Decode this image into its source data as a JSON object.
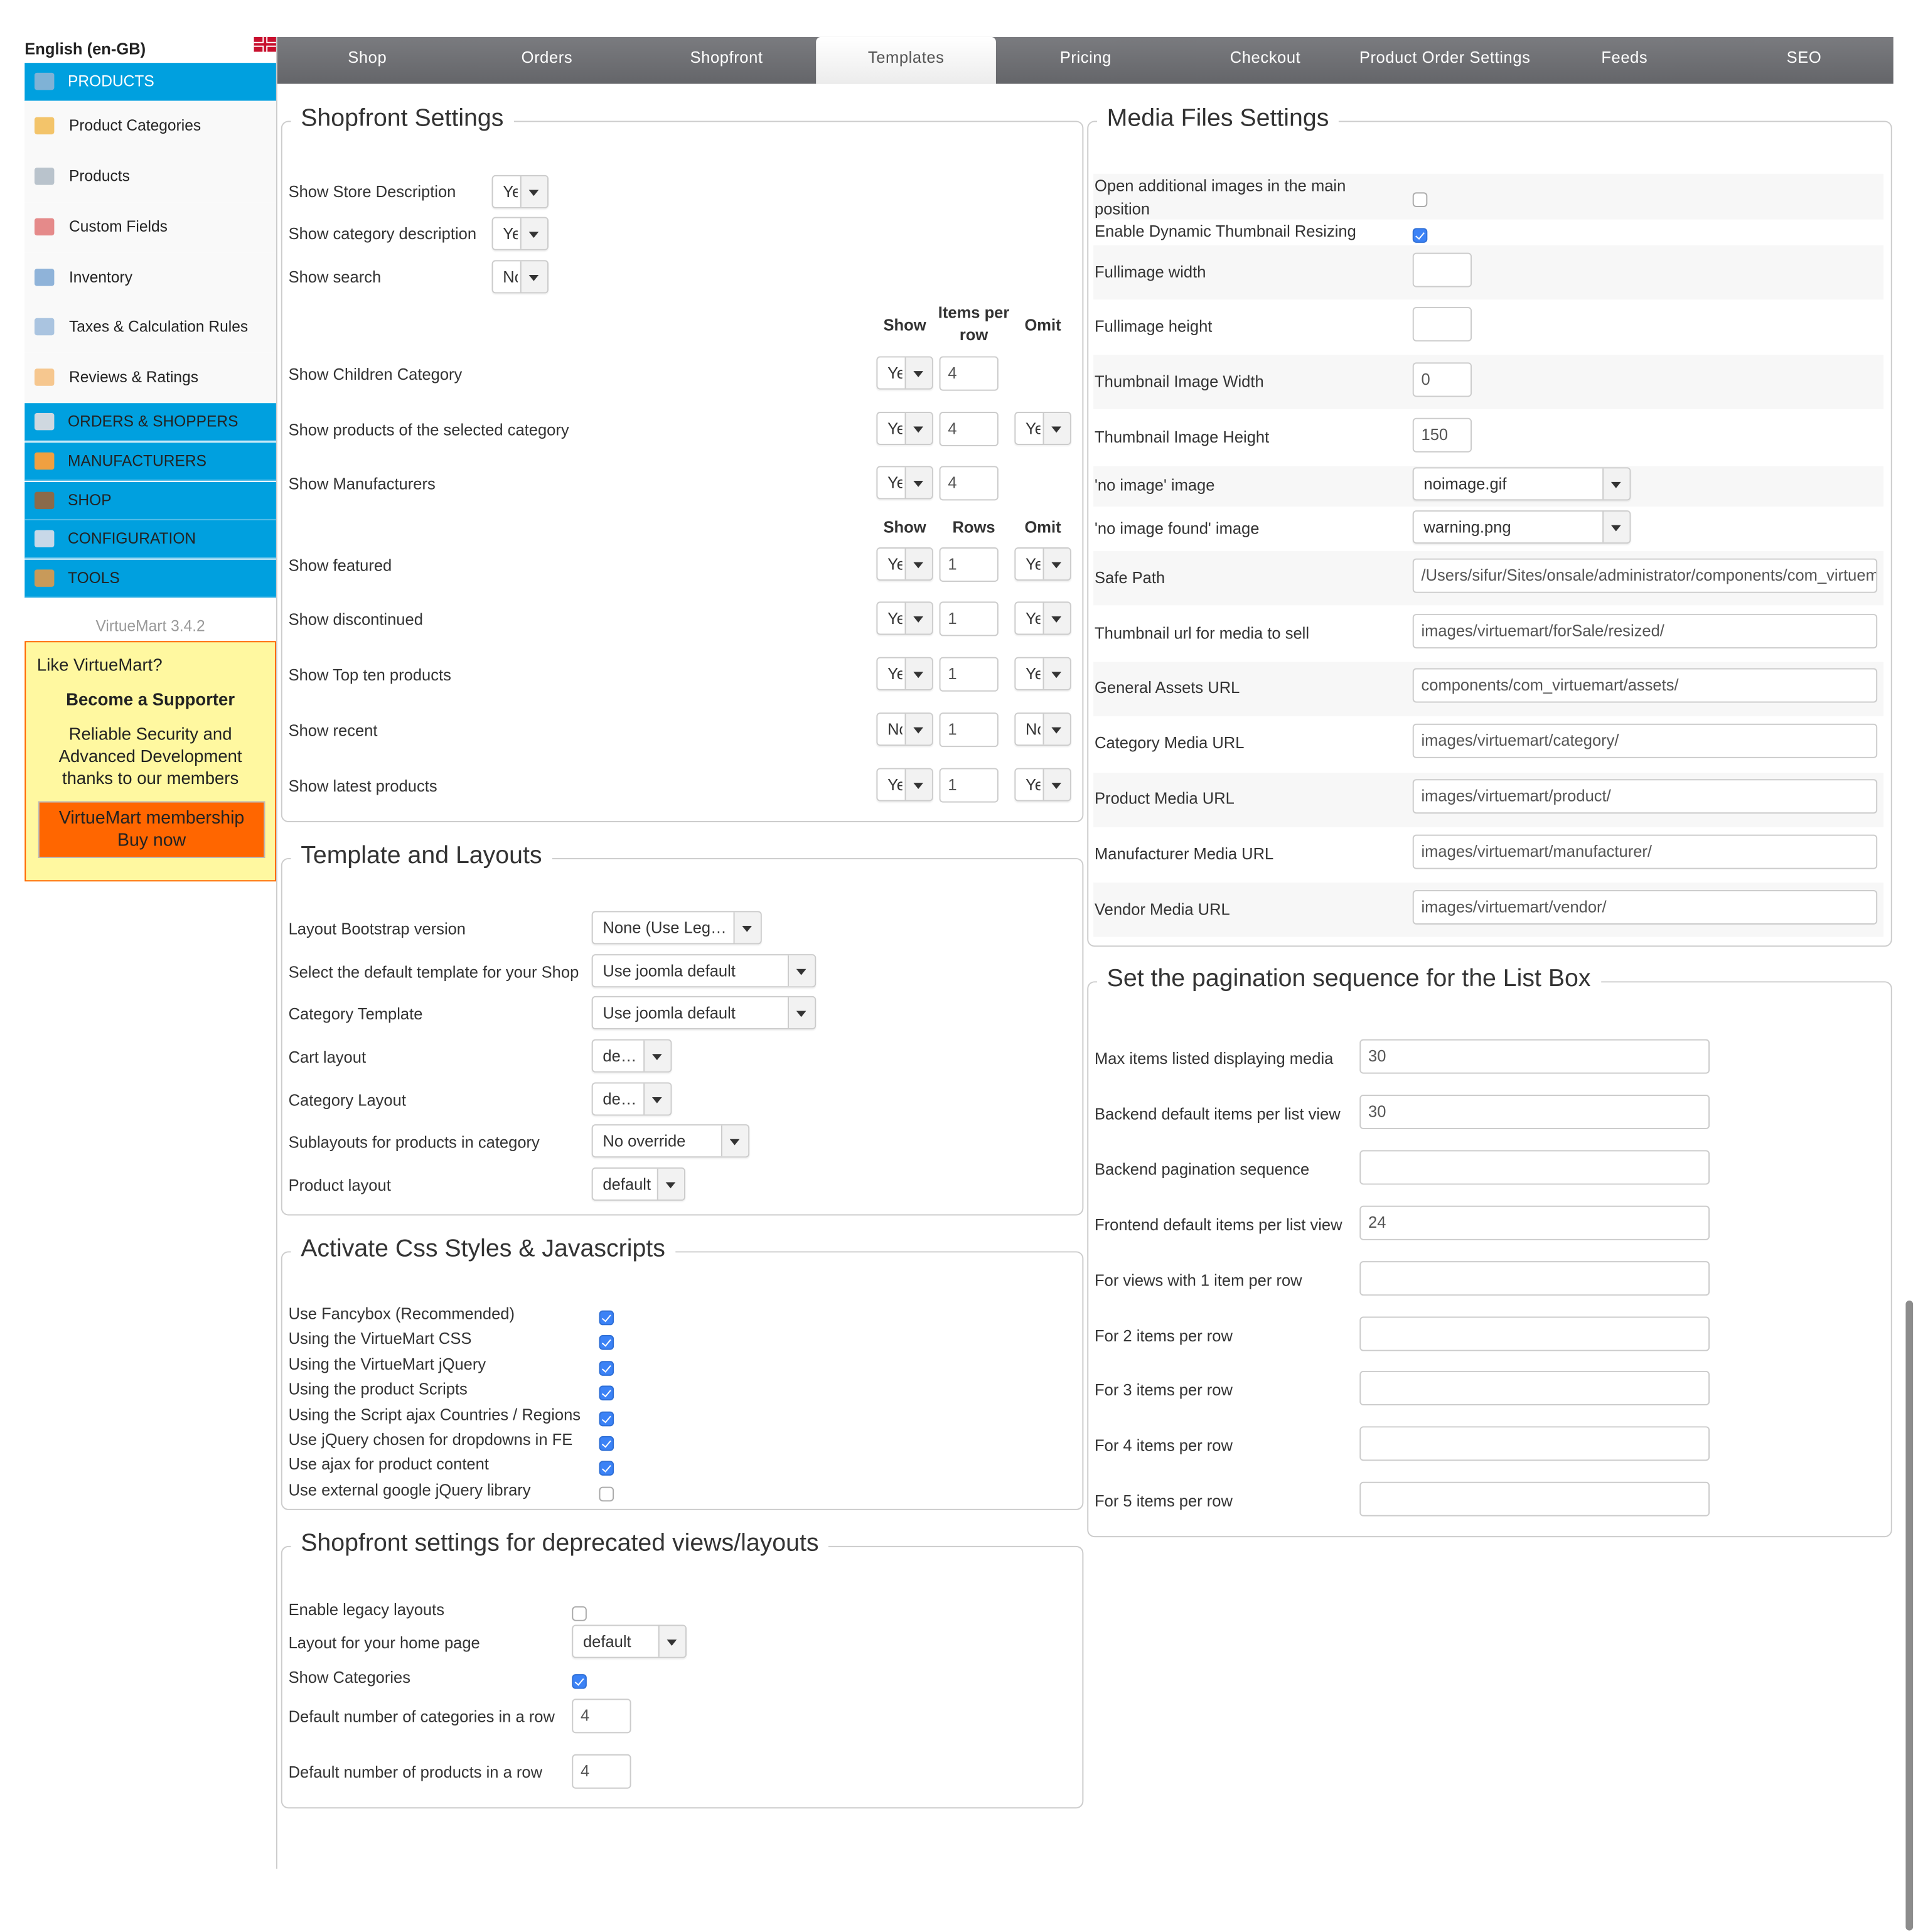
{
  "language": "English (en-GB)",
  "sidebar": {
    "products_header": "PRODUCTS",
    "items": [
      {
        "label": "Product Categories",
        "icon": "folder-icon"
      },
      {
        "label": "Products",
        "icon": "camera-icon"
      },
      {
        "label": "Custom Fields",
        "icon": "custom-fields-icon"
      },
      {
        "label": "Inventory",
        "icon": "chart-icon"
      },
      {
        "label": "Taxes & Calculation Rules",
        "icon": "calculator-icon"
      },
      {
        "label": "Reviews & Ratings",
        "icon": "speech-bubble-icon"
      }
    ],
    "sections": [
      {
        "label": "ORDERS & SHOPPERS",
        "icon": "documents-icon"
      },
      {
        "label": "MANUFACTURERS",
        "icon": "wrench-icon"
      },
      {
        "label": "SHOP",
        "icon": "shop-icon"
      },
      {
        "label": "CONFIGURATION",
        "icon": "tools-icon"
      },
      {
        "label": "TOOLS",
        "icon": "toolbox-icon"
      }
    ],
    "version": "VirtueMart 3.4.2"
  },
  "promo": {
    "question": "Like VirtueMart?",
    "headline": "Become a Supporter",
    "body": "Reliable Security and Advanced Development thanks to our members",
    "button_line1": "VirtueMart membership",
    "button_line2": "Buy now"
  },
  "tabs": [
    "Shop",
    "Orders",
    "Shopfront",
    "Templates",
    "Pricing",
    "Checkout",
    "Product Order Settings",
    "Feeds",
    "SEO"
  ],
  "active_tab": "Templates",
  "shopfront": {
    "title": "Shopfront Settings",
    "simple_rows": [
      {
        "label": "Show Store Description",
        "value": "Yes"
      },
      {
        "label": "Show category description",
        "value": "Yes"
      },
      {
        "label": "Show search",
        "value": "No"
      }
    ],
    "headers1": {
      "show": "Show",
      "items": "Items per row",
      "omit": "Omit"
    },
    "rows1": [
      {
        "label": "Show Children Category",
        "show": "Yes",
        "count": "4",
        "omit": null
      },
      {
        "label": "Show products of the selected category",
        "show": "Yes",
        "count": "4",
        "omit": "Yes"
      },
      {
        "label": "Show Manufacturers",
        "show": "Yes",
        "count": "4",
        "omit": null
      }
    ],
    "headers2": {
      "show": "Show",
      "rows": "Rows",
      "omit": "Omit"
    },
    "rows2": [
      {
        "label": "Show featured",
        "show": "Yes",
        "count": "1",
        "omit": "Yes"
      },
      {
        "label": "Show discontinued",
        "show": "Yes",
        "count": "1",
        "omit": "Yes"
      },
      {
        "label": "Show Top ten products",
        "show": "Yes",
        "count": "1",
        "omit": "Yes"
      },
      {
        "label": "Show recent",
        "show": "No",
        "count": "1",
        "omit": "No"
      },
      {
        "label": "Show latest products",
        "show": "Yes",
        "count": "1",
        "omit": "Yes"
      }
    ]
  },
  "layouts": {
    "title": "Template and Layouts",
    "rows": [
      {
        "label": "Layout Bootstrap version",
        "value": "None (Use Legacy)"
      },
      {
        "label": "Select the default template for your Shop",
        "value": "Use joomla default"
      },
      {
        "label": "Category Template",
        "value": "Use joomla default"
      },
      {
        "label": "Cart layout",
        "value": "default"
      },
      {
        "label": "Category Layout",
        "value": "default"
      },
      {
        "label": "Sublayouts for products in category",
        "value": "No override"
      },
      {
        "label": "Product layout",
        "value": "default"
      }
    ]
  },
  "css": {
    "title": "Activate Css Styles & Javascripts",
    "rows": [
      {
        "label": "Use Fancybox (Recommended)",
        "checked": true
      },
      {
        "label": "Using the VirtueMart CSS",
        "checked": true
      },
      {
        "label": "Using the VirtueMart jQuery",
        "checked": true
      },
      {
        "label": "Using the product Scripts",
        "checked": true
      },
      {
        "label": "Using the Script ajax Countries / Regions",
        "checked": true
      },
      {
        "label": "Use jQuery chosen for dropdowns in FE",
        "checked": true
      },
      {
        "label": "Use ajax for product content",
        "checked": true
      },
      {
        "label": "Use external google jQuery library",
        "checked": false
      }
    ]
  },
  "deprecated": {
    "title": "Shopfront settings for deprecated views/layouts",
    "enable_legacy": {
      "label": "Enable legacy layouts",
      "checked": false
    },
    "home_layout": {
      "label": "Layout for your home page",
      "value": "default"
    },
    "show_categories": {
      "label": "Show Categories",
      "checked": true
    },
    "cats_per_row": {
      "label": "Default number of categories in a row",
      "value": "4"
    },
    "products_per_row": {
      "label": "Default number of products in a row",
      "value": "4"
    }
  },
  "media": {
    "title": "Media Files Settings",
    "rows": [
      {
        "label": "Open additional images in the main position",
        "type": "checkbox",
        "checked": false
      },
      {
        "label": "Enable Dynamic Thumbnail Resizing",
        "type": "checkbox",
        "checked": true
      },
      {
        "label": "Fullimage width",
        "type": "small",
        "value": ""
      },
      {
        "label": "Fullimage height",
        "type": "small",
        "value": ""
      },
      {
        "label": "Thumbnail Image Width",
        "type": "small",
        "value": "0"
      },
      {
        "label": "Thumbnail Image Height",
        "type": "small",
        "value": "150"
      },
      {
        "label": "'no image' image",
        "type": "select",
        "value": "noimage.gif"
      },
      {
        "label": "'no image found' image",
        "type": "select",
        "value": "warning.png"
      },
      {
        "label": "Safe Path",
        "type": "wide",
        "value": "/Users/sifur/Sites/onsale/administrator/components/com_virtuemart/"
      },
      {
        "label": "Thumbnail url for media to sell",
        "type": "wide",
        "value": "images/virtuemart/forSale/resized/"
      },
      {
        "label": "General Assets URL",
        "type": "wide",
        "value": "components/com_virtuemart/assets/"
      },
      {
        "label": "Category Media URL",
        "type": "wide",
        "value": "images/virtuemart/category/"
      },
      {
        "label": "Product Media URL",
        "type": "wide",
        "value": "images/virtuemart/product/"
      },
      {
        "label": "Manufacturer Media URL",
        "type": "wide",
        "value": "images/virtuemart/manufacturer/"
      },
      {
        "label": "Vendor Media URL",
        "type": "wide",
        "value": "images/virtuemart/vendor/"
      }
    ]
  },
  "pagination": {
    "title": "Set the pagination sequence for the List Box",
    "rows": [
      {
        "label": "Max items listed displaying media",
        "value": "30"
      },
      {
        "label": "Backend default items per list view",
        "value": "30"
      },
      {
        "label": "Backend pagination sequence",
        "value": ""
      },
      {
        "label": "Frontend default items per list view",
        "value": "24"
      },
      {
        "label": "For views with 1 item per row",
        "value": ""
      },
      {
        "label": "For 2 items per row",
        "value": ""
      },
      {
        "label": "For 3 items per row",
        "value": ""
      },
      {
        "label": "For 4 items per row",
        "value": ""
      },
      {
        "label": "For 5 items per row",
        "value": ""
      }
    ]
  },
  "colors": {
    "sidebar_blue": "#00a0df",
    "tabbar": "#6b6c70",
    "promo_bg": "#fff8a0",
    "promo_button": "#ff6600",
    "checkbox": "#3b82f6"
  }
}
